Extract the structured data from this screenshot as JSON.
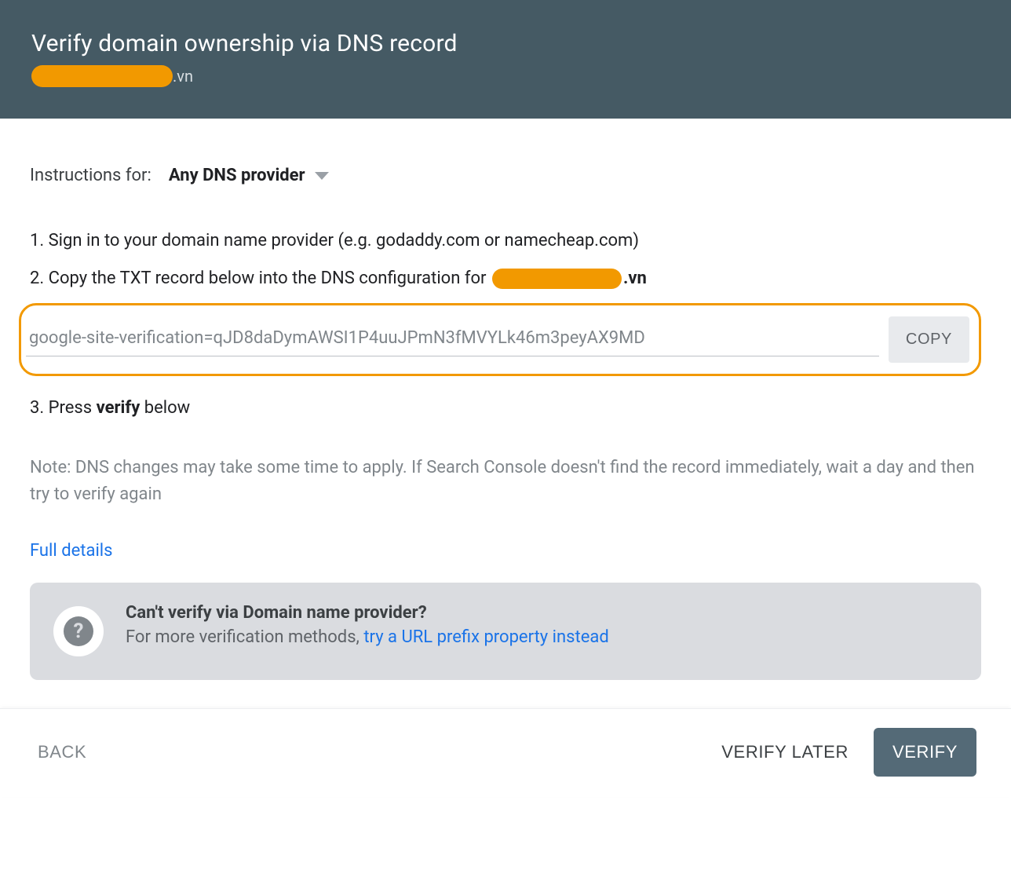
{
  "header": {
    "title": "Verify domain ownership via DNS record",
    "domain_suffix": ".vn"
  },
  "instructions": {
    "label": "Instructions for:",
    "provider": "Any DNS provider"
  },
  "steps": {
    "s1": "1. Sign in to your domain name provider (e.g. godaddy.com or namecheap.com)",
    "s2_prefix": "2. Copy the TXT record below into the DNS configuration for ",
    "s2_domain_suffix": ".vn",
    "s3_prefix": "3. Press ",
    "s3_bold": "verify",
    "s3_suffix": " below"
  },
  "txt_record": {
    "value": "google-site-verification=qJD8daDymAWSI1P4uuJPmN3fMVYLk46m3peyAX9MD",
    "copy_label": "COPY"
  },
  "note": "Note: DNS changes may take some time to apply. If Search Console doesn't find the record immediately, wait a day and then try to verify again",
  "full_details": "Full details",
  "alt": {
    "title": "Can't verify via Domain name provider?",
    "text_prefix": "For more verification methods, ",
    "link": "try a URL prefix property instead"
  },
  "footer": {
    "back": "BACK",
    "verify_later": "VERIFY LATER",
    "verify": "VERIFY"
  }
}
